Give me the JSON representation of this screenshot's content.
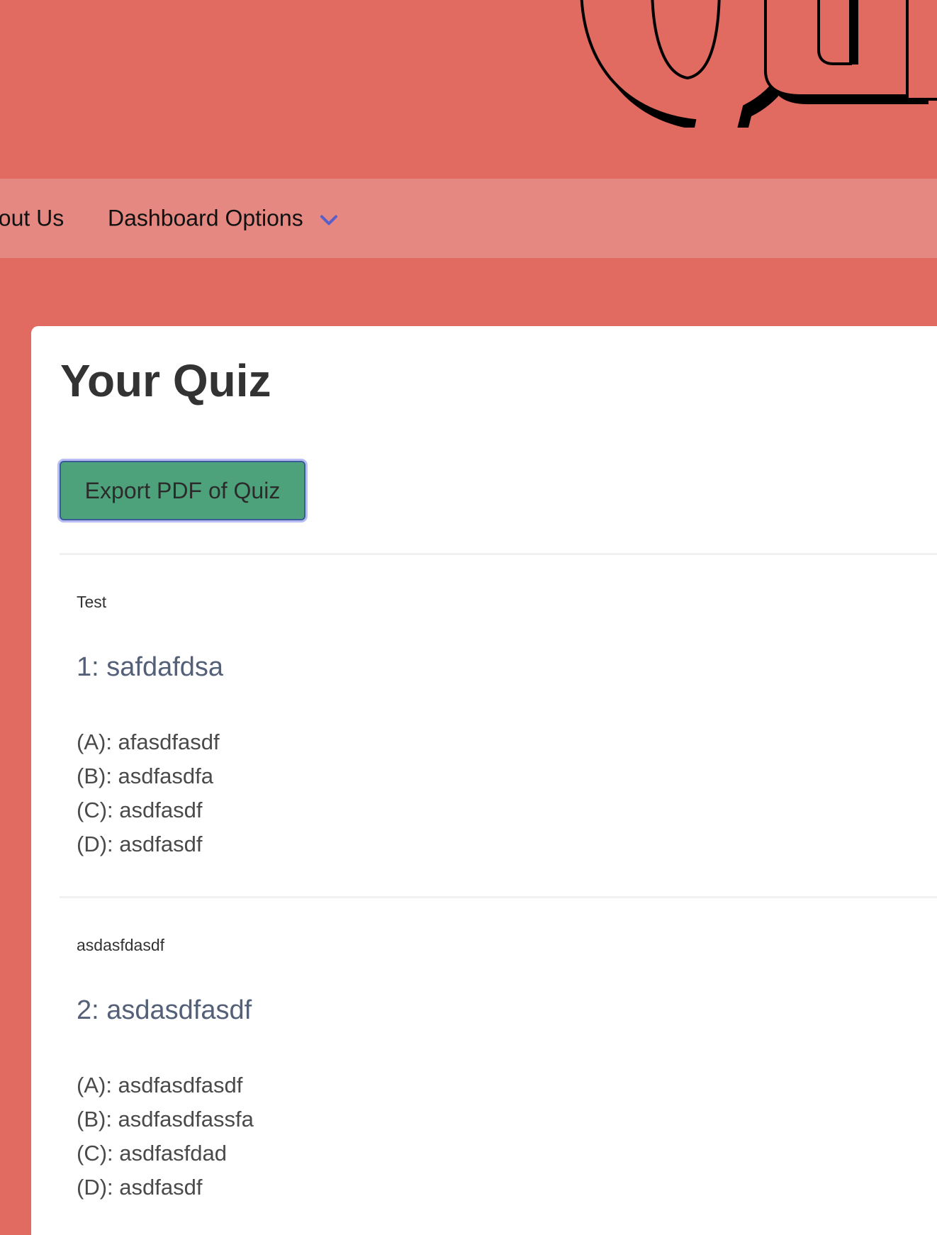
{
  "header": {
    "logo_text": "Qu"
  },
  "nav": {
    "about_label": "bout Us",
    "dashboard_label": "Dashboard Options"
  },
  "main": {
    "title": "Your Quiz",
    "export_label": "Export PDF of Quiz",
    "questions": [
      {
        "note": "Test",
        "title": "1: safdafdsa",
        "answers": [
          "(A): afasdfasdf",
          "(B): asdfasdfa",
          "(C): asdfasdf",
          "(D): asdfasdf"
        ]
      },
      {
        "note": "asdasfdasdf",
        "title": "2: asdasdfasdf",
        "answers": [
          "(A): asdfasdfasdf",
          "(B): asdfasdfassfa",
          "(C): asdfasfdad",
          "(D): asdfasdf"
        ]
      }
    ]
  },
  "colors": {
    "background": "#e16a61",
    "navbar": "#e58881",
    "button": "#4ea27b",
    "chevron": "#5a5fc7",
    "question_title": "#546078"
  },
  "icons": {
    "dropdown": "chevron-down-icon"
  }
}
